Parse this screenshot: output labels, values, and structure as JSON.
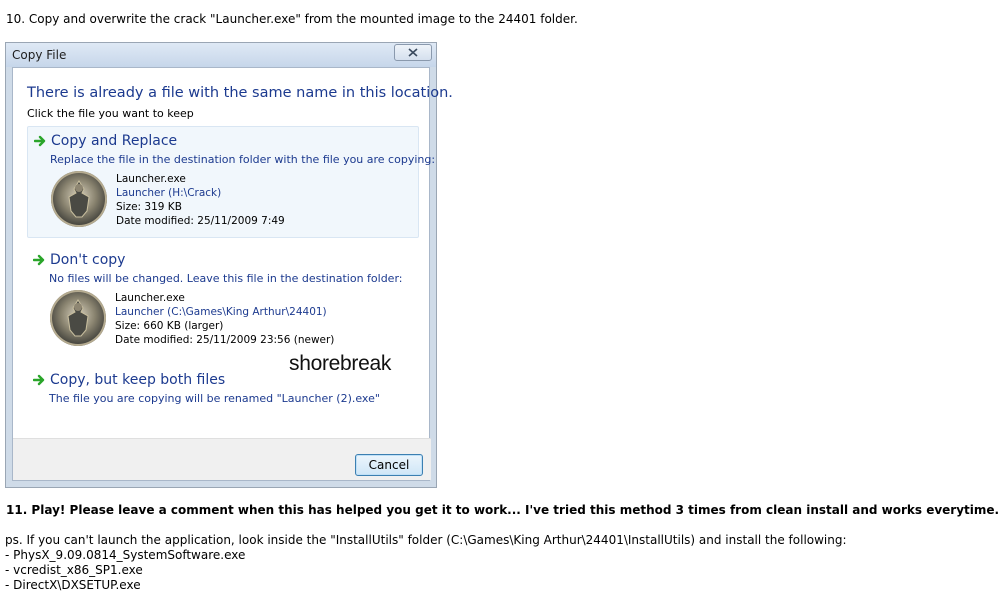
{
  "step10_text": "10. Copy and overwrite the crack \"Launcher.exe\" from the mounted image to the 24401 folder.",
  "dialog": {
    "title": "Copy File",
    "headline": "There is already a file with the same name in this location.",
    "subhead": "Click the file you want to keep",
    "options": [
      {
        "title": "Copy and Replace",
        "description": "Replace the file in the destination folder with the file you are copying:",
        "file": {
          "name": "Launcher.exe",
          "location": "Launcher (H:\\Crack)",
          "size": "Size: 319 KB",
          "modified": "Date modified: 25/11/2009 7:49"
        }
      },
      {
        "title": "Don't copy",
        "description": "No files will be changed. Leave this file in the destination folder:",
        "file": {
          "name": "Launcher.exe",
          "location": "Launcher (C:\\Games\\King Arthur\\24401)",
          "size": "Size: 660 KB (larger)",
          "modified": "Date modified: 25/11/2009 23:56 (newer)"
        }
      },
      {
        "title": "Copy, but keep both files",
        "description": "The file you are copying will be renamed \"Launcher (2).exe\""
      }
    ],
    "watermark": "shorebreak",
    "cancel_label": "Cancel"
  },
  "step11_text": "11. Play! Please leave a comment when this has helped you get it to work... I've tried this method 3 times from clean install and works everytime.",
  "ps": {
    "intro": "ps. If you can't launch the application, look inside the \"InstallUtils\" folder (C:\\Games\\King Arthur\\24401\\InstallUtils) and install the following:",
    "items": [
      "- PhysX_9.09.0814_SystemSoftware.exe",
      "- vcredist_x86_SP1.exe",
      "- DirectX\\DXSETUP.exe"
    ]
  },
  "colors": {
    "dialog_link_blue": "#1c3a8f",
    "arrow_green": "#2aa52a",
    "selected_option_bg": "#f1f7fc"
  },
  "icons": [
    "green-arrow-icon",
    "knight-file-icon",
    "close-icon"
  ]
}
